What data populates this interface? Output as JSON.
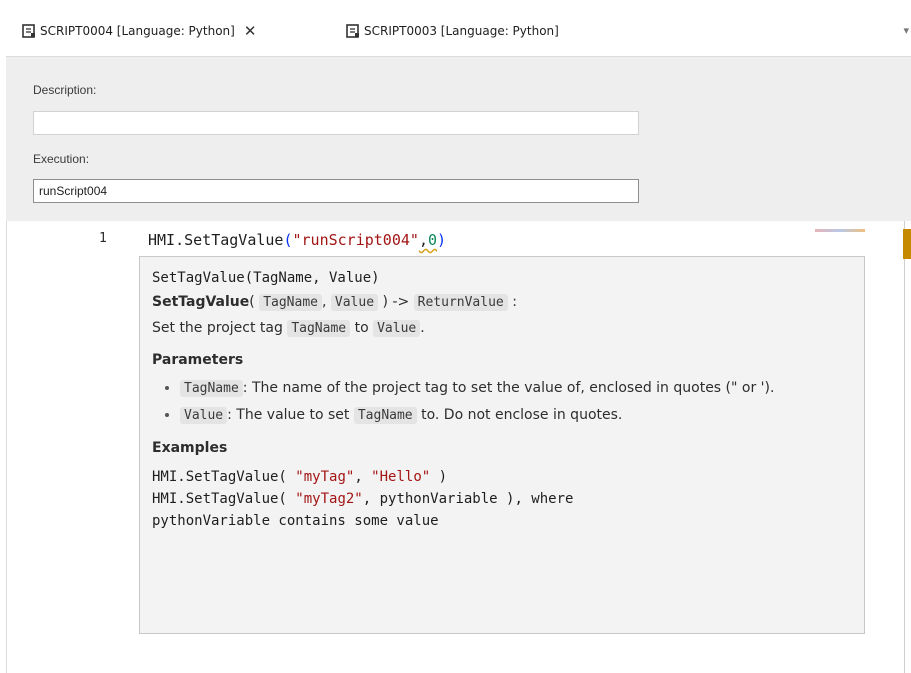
{
  "tabs": [
    {
      "label": "SCRIPT0004 [Language: Python]",
      "icon": "script-document-icon",
      "active": true
    },
    {
      "label": "SCRIPT0003 [Language: Python]",
      "icon": "script-document-icon",
      "active": false
    }
  ],
  "tab_close_glyph": "✕",
  "tab_dropdown_glyph": "▾",
  "properties": {
    "description_label": "Description:",
    "description_value": "",
    "execution_label": "Execution:",
    "execution_value": "runScript004"
  },
  "editor": {
    "line_number": "1",
    "code": {
      "prefix": "HMI.SetTagValue",
      "open_paren": "(",
      "string_arg": "\"runScript004\"",
      "comma": ",",
      "number_arg": "0",
      "close_paren": ")"
    }
  },
  "hover": {
    "signature": "SetTagValue(TagName, Value)",
    "sig_name": "SetTagValue",
    "sig_open": "(",
    "sig_param1": "TagName",
    "sig_sep": ",",
    "sig_param2": "Value",
    "sig_close_arrow": ") ->",
    "sig_return": "ReturnValue",
    "sig_colon": ":",
    "desc_prefix": "Set the project tag",
    "desc_param1": "TagName",
    "desc_to": "to",
    "desc_param2": "Value",
    "desc_period": ".",
    "parameters_heading": "Parameters",
    "param_items": [
      {
        "name": "TagName",
        "text": ": The name of the project tag to set the value of, enclosed in quotes (\" or ')."
      },
      {
        "name": "Value",
        "text_before": ": The value to set",
        "ref": "TagName",
        "text_after": "to. Do not enclose in quotes."
      }
    ],
    "examples_heading": "Examples",
    "example_lines": [
      {
        "pre": "HMI.SetTagValue( ",
        "s1": "\"myTag\"",
        "mid": ", ",
        "s2": "\"Hello\"",
        "post": " )"
      },
      {
        "pre": "HMI.SetTagValue( ",
        "s1": "\"myTag2\"",
        "mid": ", pythonVariable ), where",
        "s2": "",
        "post": ""
      },
      {
        "pre": "pythonVariable contains some value",
        "s1": "",
        "mid": "",
        "s2": "",
        "post": ""
      }
    ]
  },
  "colors": {
    "string": "#a31515",
    "number": "#098658",
    "panel_bg": "#eeeeee",
    "hover_bg": "#f3f3f3"
  }
}
